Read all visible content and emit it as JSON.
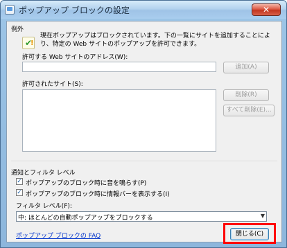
{
  "window": {
    "title": "ポップアップ ブロックの設定",
    "close_glyph": "✕"
  },
  "exceptions": {
    "group_label": "例外",
    "description": "現在ポップアップはブロックされています。下の一覧にサイトを追加することにより、特定の Web サイトのポップアップを許可できます。",
    "address_label": "許可する Web サイトのアドレス(W):",
    "address_value": "",
    "add_button": "追加(A)",
    "allowed_label": "許可されたサイト(S):",
    "remove_button": "削除(R)",
    "remove_all_button": "すべて削除(E)..."
  },
  "notifications": {
    "group_label": "通知とフィルタ レベル",
    "sound_checkbox": {
      "label": "ポップアップのブロック時に音を鳴らす(P)",
      "checked": true
    },
    "infobar_checkbox": {
      "label": "ポップアップのブロック時に情報バーを表示する(I)",
      "checked": true
    },
    "filter_label": "フィルタ レベル(F):",
    "filter_value": "中: ほとんどの自動ポップアップをブロックする"
  },
  "footer": {
    "faq_link": "ポップアップ ブロックの FAQ",
    "close_button": "閉じる(C)"
  },
  "colors": {
    "highlight": "#ff0000",
    "link": "#0033cc"
  },
  "icons": [
    "popup-blocker-icon",
    "info-check-icon",
    "close-icon",
    "dropdown-arrow-icon",
    "checkmark-icon"
  ]
}
